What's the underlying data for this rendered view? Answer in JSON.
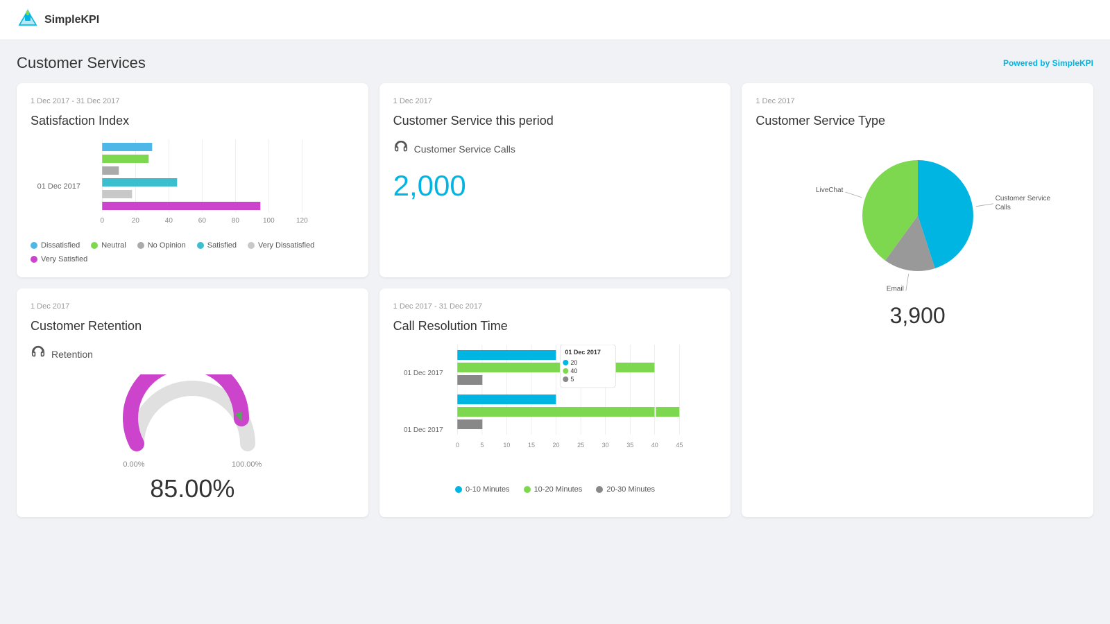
{
  "app": {
    "name": "SimpleKPI",
    "powered_by_prefix": "Powered by ",
    "powered_by_brand": "SimpleKPI"
  },
  "page": {
    "title": "Customer Services"
  },
  "satisfaction_index": {
    "date_range": "1 Dec 2017 - 31 Dec 2017",
    "title": "Satisfaction Index",
    "y_label": "01 Dec 2017",
    "x_ticks": [
      "0",
      "20",
      "40",
      "60",
      "80",
      "100",
      "120"
    ],
    "bars": [
      {
        "label": "Dissatisfied",
        "value": 30,
        "color": "#4db8e8"
      },
      {
        "label": "Neutral",
        "value": 28,
        "color": "#7ed84f"
      },
      {
        "label": "No Opinion",
        "value": 10,
        "color": "#aaaaaa"
      },
      {
        "label": "Satisfied",
        "value": 45,
        "color": "#3bbfce"
      },
      {
        "label": "Very Dissatisfied",
        "value": 18,
        "color": "#c8c8c8"
      },
      {
        "label": "Very Satisfied",
        "value": 95,
        "color": "#cc44cc"
      }
    ],
    "legend": [
      {
        "label": "Dissatisfied",
        "color": "#4db8e8"
      },
      {
        "label": "Neutral",
        "color": "#7ed84f"
      },
      {
        "label": "No Opinion",
        "color": "#aaaaaa"
      },
      {
        "label": "Satisfied",
        "color": "#3bbfce"
      },
      {
        "label": "Very Dissatisfied",
        "color": "#c8c8c8"
      },
      {
        "label": "Very Satisfied",
        "color": "#cc44cc"
      }
    ]
  },
  "service_period": {
    "date": "1 Dec 2017",
    "title": "Customer Service this period",
    "metric_label": "Customer Service Calls",
    "metric_value": "2,000"
  },
  "service_type": {
    "date": "1 Dec 2017",
    "title": "Customer Service Type",
    "total": "3,900",
    "slices": [
      {
        "label": "Customer Service Calls",
        "color": "#00b5e2",
        "percent": 45,
        "angle_start": -20,
        "angle_end": 145
      },
      {
        "label": "Email",
        "color": "#888",
        "percent": 15,
        "angle_start": 145,
        "angle_end": 200
      },
      {
        "label": "LiveChat",
        "color": "#7ed84f",
        "percent": 40,
        "angle_start": 200,
        "angle_end": 340
      }
    ]
  },
  "retention": {
    "date": "1 Dec 2017",
    "title": "Customer Retention",
    "metric_label": "Retention",
    "gauge_min": "0.00%",
    "gauge_max": "100.00%",
    "value": "85.00%",
    "value_numeric": 85
  },
  "call_resolution": {
    "date_range": "1 Dec 2017 - 31 Dec 2017",
    "title": "Call Resolution Time",
    "x_ticks": [
      "0",
      "5",
      "10",
      "15",
      "20",
      "25",
      "30",
      "35",
      "40",
      "45"
    ],
    "y_labels": [
      "01 Dec 2017",
      "01 Dec 2017"
    ],
    "tooltip": {
      "label": "01 Dec 2017",
      "values": [
        {
          "color": "#00b5e2",
          "value": "20"
        },
        {
          "color": "#7ed84f",
          "value": "40"
        },
        {
          "color": "#888",
          "value": "5"
        }
      ]
    },
    "series": [
      {
        "label": "0-10 Minutes",
        "color": "#00b5e2",
        "rows": [
          20,
          20
        ]
      },
      {
        "label": "10-20 Minutes",
        "color": "#7ed84f",
        "rows": [
          40,
          40
        ]
      },
      {
        "label": "20-30 Minutes",
        "color": "#888",
        "rows": [
          5,
          5
        ]
      }
    ],
    "legend": [
      {
        "label": "0-10 Minutes",
        "color": "#00b5e2"
      },
      {
        "label": "10-20 Minutes",
        "color": "#7ed84f"
      },
      {
        "label": "20-30 Minutes",
        "color": "#888"
      }
    ]
  }
}
